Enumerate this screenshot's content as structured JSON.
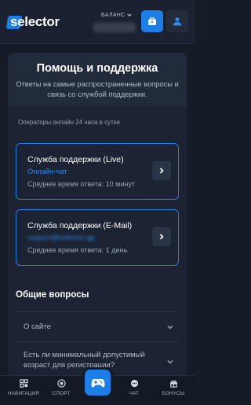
{
  "header": {
    "logo_text": "selector",
    "balance_label": "БАЛАНС",
    "colors": {
      "accent": "#1e7ee8",
      "background": "#1a2130"
    }
  },
  "support": {
    "title": "Помощь и поддержка",
    "subtitle": "Ответы на самые распространенные вопросы и связь со службой поддержки.",
    "operators": "Операторы онлайн 24 часа в сутки",
    "cards": [
      {
        "title": "Служба поддержки (Live)",
        "link": "Онлайн-чат",
        "meta": "Среднее время ответа: 10 минут"
      },
      {
        "title": "Служба поддержки (E-Mail)",
        "link": "support@selector.gg",
        "meta": "Среднее время ответа: 1 день"
      }
    ]
  },
  "faq": {
    "title": "Общие вопросы",
    "items": [
      {
        "label": "О сайте"
      },
      {
        "label": "Есть ли минимальный допустимый возраст для регистрации?"
      }
    ]
  },
  "bottom_nav": {
    "items": [
      {
        "label": "НАВИГАЦИЯ",
        "icon": "navigation-icon"
      },
      {
        "label": "СПОРТ",
        "icon": "soccer-ball-icon"
      },
      {
        "label": "ЧАТ",
        "icon": "chat-icon"
      },
      {
        "label": "БОНУСЫ",
        "icon": "gift-icon"
      }
    ],
    "center_icon": "gamepad-icon"
  }
}
